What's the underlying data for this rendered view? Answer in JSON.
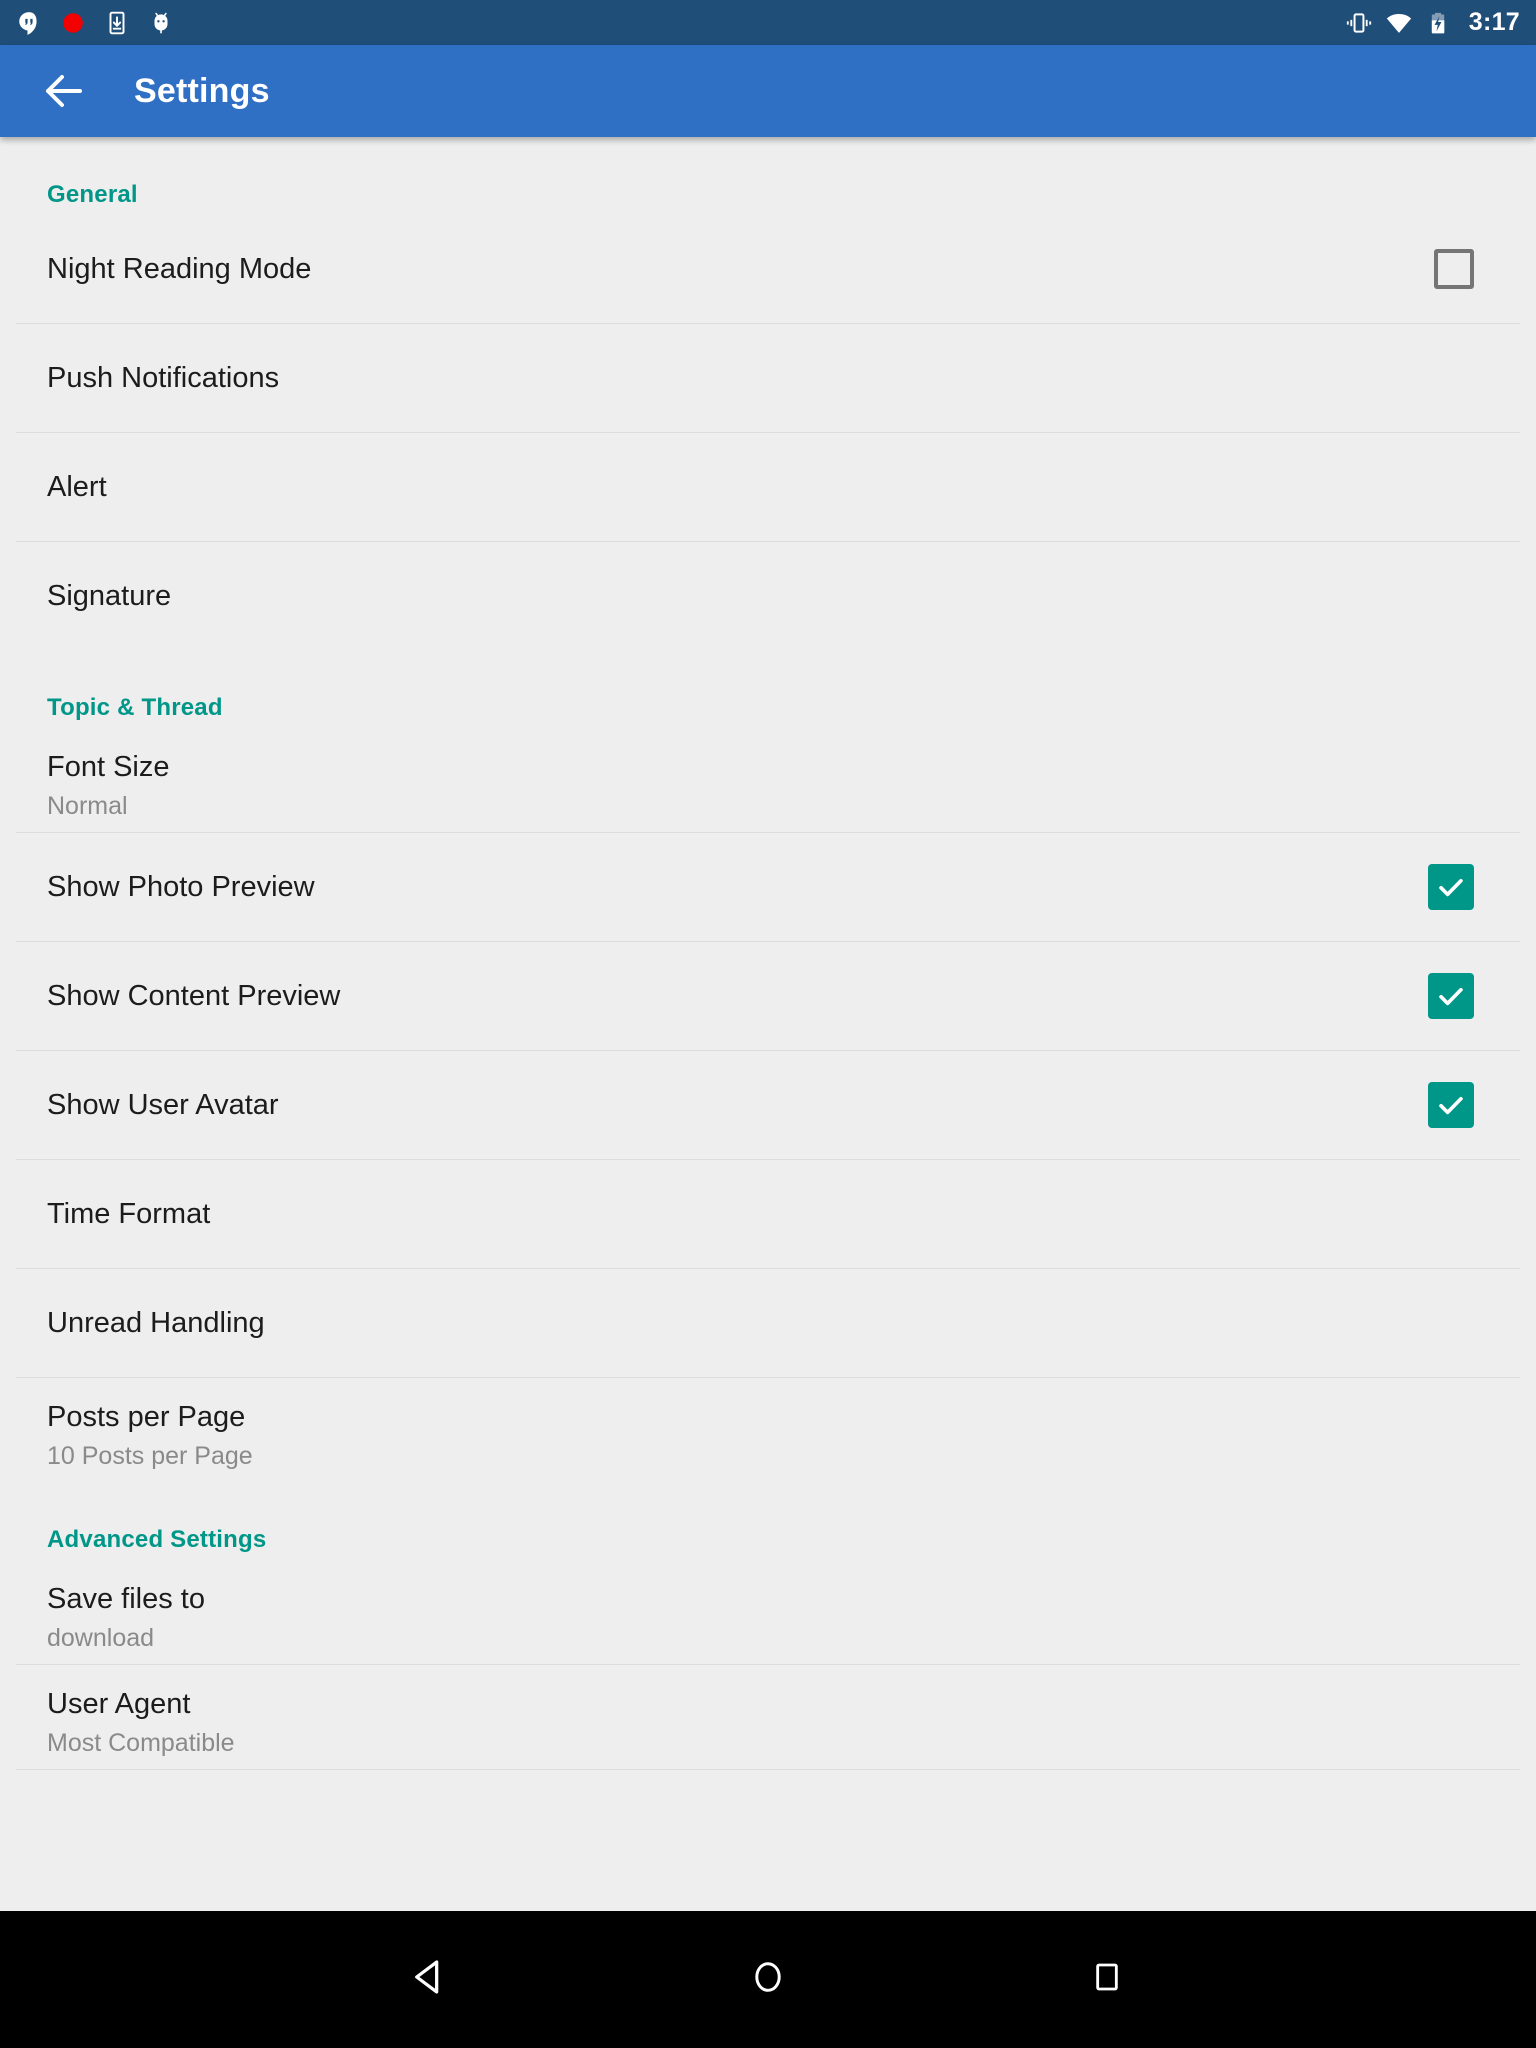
{
  "status_bar": {
    "background_color": "#1f4e79",
    "time": "3:17",
    "left_icons": [
      "hangouts-icon",
      "record-dot-icon",
      "download-to-device-icon",
      "android-bug-icon"
    ],
    "right_icons": [
      "vibrate-icon",
      "wifi-icon",
      "battery-charging-icon"
    ]
  },
  "app_bar": {
    "background_color": "#2f6fc4",
    "back_icon": "back-arrow-icon",
    "title": "Settings"
  },
  "theme": {
    "accent_color": "#009688",
    "background_color": "#eeeeee",
    "title_text_color": "#1c1c1c",
    "subtitle_text_color": "#8a8a8a",
    "divider_color": "#dcdcdc"
  },
  "sections": [
    {
      "header": "General",
      "rows": [
        {
          "title": "Night Reading Mode",
          "subtitle": null,
          "control": "checkbox",
          "checked": false
        },
        {
          "title": "Push Notifications",
          "subtitle": null,
          "control": "none",
          "checked": null
        },
        {
          "title": "Alert",
          "subtitle": null,
          "control": "none",
          "checked": null
        },
        {
          "title": "Signature",
          "subtitle": null,
          "control": "none",
          "checked": null
        }
      ]
    },
    {
      "header": "Topic & Thread",
      "rows": [
        {
          "title": "Font Size",
          "subtitle": "Normal",
          "control": "none",
          "checked": null
        },
        {
          "title": "Show Photo Preview",
          "subtitle": null,
          "control": "checkbox",
          "checked": true
        },
        {
          "title": "Show Content Preview",
          "subtitle": null,
          "control": "checkbox",
          "checked": true
        },
        {
          "title": "Show User Avatar",
          "subtitle": null,
          "control": "checkbox",
          "checked": true
        },
        {
          "title": "Time Format",
          "subtitle": null,
          "control": "none",
          "checked": null
        },
        {
          "title": "Unread Handling",
          "subtitle": null,
          "control": "none",
          "checked": null
        },
        {
          "title": "Posts per Page",
          "subtitle": "10 Posts per Page",
          "control": "none",
          "checked": null
        }
      ]
    },
    {
      "header": "Advanced Settings",
      "rows": [
        {
          "title": "Save files to",
          "subtitle": "download",
          "control": "none",
          "checked": null
        },
        {
          "title": "User Agent",
          "subtitle": "Most Compatible",
          "control": "none",
          "checked": null
        }
      ]
    }
  ],
  "nav_bar": {
    "background_color": "#000000",
    "buttons": [
      {
        "name": "back-nav-button",
        "icon": "triangle-back-icon"
      },
      {
        "name": "home-nav-button",
        "icon": "circle-home-icon"
      },
      {
        "name": "recents-nav-button",
        "icon": "square-recents-icon"
      }
    ]
  }
}
